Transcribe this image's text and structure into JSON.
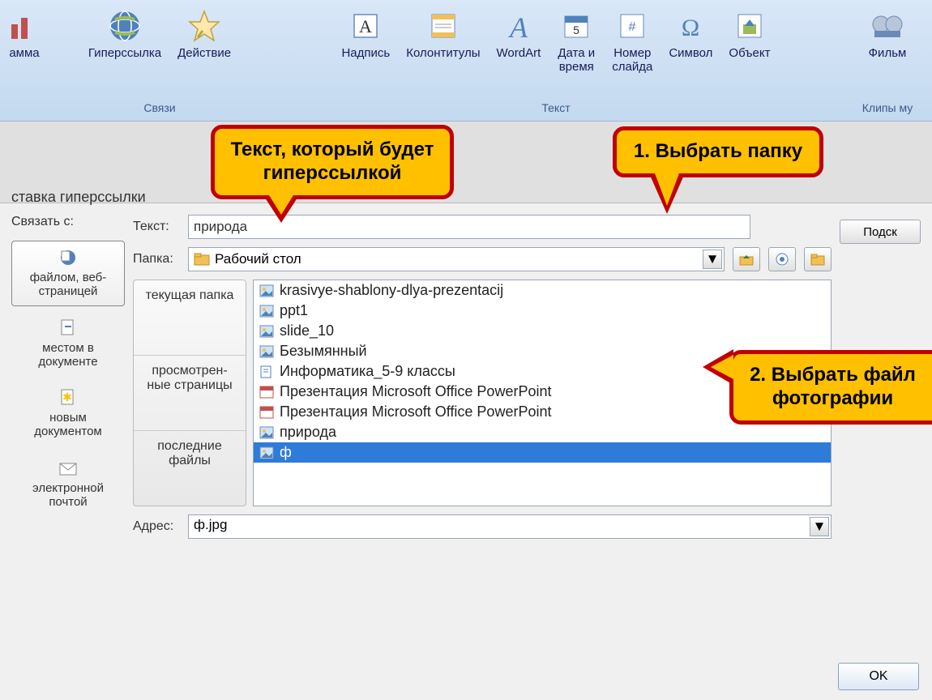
{
  "ribbon": {
    "groups": [
      {
        "name": "",
        "items": [
          {
            "label": "амма",
            "icon": "chart-icon"
          }
        ]
      },
      {
        "name": "Связи",
        "items": [
          {
            "label": "Гиперссылка",
            "icon": "globe-icon"
          },
          {
            "label": "Действие",
            "icon": "star-icon"
          }
        ]
      },
      {
        "name": "Текст",
        "items": [
          {
            "label": "Надпись",
            "icon": "textbox-icon"
          },
          {
            "label": "Колонтитулы",
            "icon": "header-footer-icon"
          },
          {
            "label": "WordArt",
            "icon": "wordart-icon"
          },
          {
            "label": "Дата и\nвремя",
            "icon": "date-icon"
          },
          {
            "label": "Номер\nслайда",
            "icon": "slide-number-icon"
          },
          {
            "label": "Символ",
            "icon": "symbol-icon"
          },
          {
            "label": "Объект",
            "icon": "object-icon"
          }
        ]
      },
      {
        "name": "Клипы му",
        "items": [
          {
            "label": "Фильм",
            "icon": "movie-icon"
          }
        ]
      }
    ]
  },
  "dialog": {
    "title": "ставка гиперссылки",
    "link_to_label": "Связать с:",
    "link_types": [
      "файлом, веб-\nстраницей",
      "местом в\nдокументе",
      "новым\nдокументом",
      "электронной\nпочтой"
    ],
    "text_label": "Текст:",
    "text_value": "природа",
    "folder_label": "Папка:",
    "folder_value": "Рабочий стол",
    "browse_tabs": [
      "текущая\nпапка",
      "просмотрен-\nные\nстраницы",
      "последние\nфайлы"
    ],
    "files": [
      {
        "name": "krasivye-shablony-dlya-prezentacij",
        "type": "image"
      },
      {
        "name": "ppt1",
        "type": "image"
      },
      {
        "name": "slide_10",
        "type": "image"
      },
      {
        "name": "Безымянный",
        "type": "image"
      },
      {
        "name": "Информатика_5-9 классы",
        "type": "doc"
      },
      {
        "name": "Презентация Microsoft Office PowerPoint",
        "type": "ppt"
      },
      {
        "name": "Презентация Microsoft Office PowerPoint",
        "type": "ppt"
      },
      {
        "name": "природа",
        "type": "image"
      },
      {
        "name": "ф",
        "type": "image",
        "selected": true
      }
    ],
    "address_label": "Адрес:",
    "address_value": "ф.jpg",
    "tooltip_button": "Подск",
    "ok": "OK"
  },
  "callouts": {
    "c1": "Текст, который будет гиперссылкой",
    "c2": "1. Выбрать папку",
    "c3": "2. Выбрать файл фотографии"
  }
}
